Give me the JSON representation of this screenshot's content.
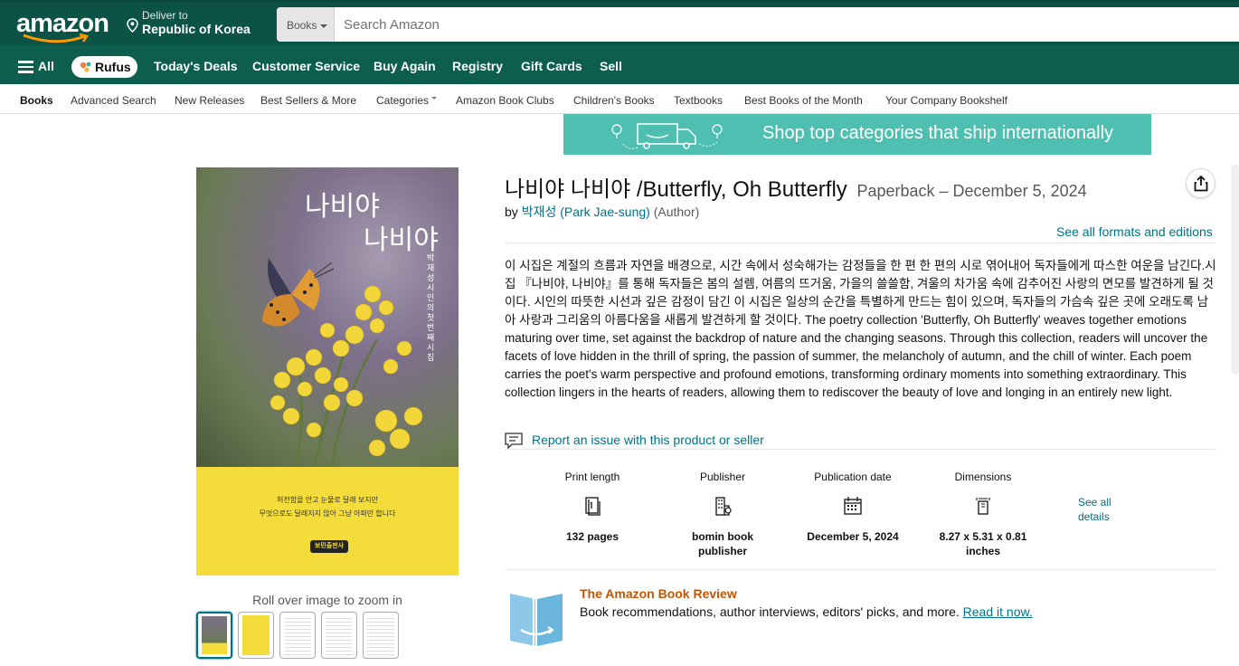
{
  "header": {
    "logo_text": "amazon",
    "deliver_label": "Deliver to",
    "deliver_location": "Republic of Korea",
    "search_category": "Books",
    "search_placeholder": "Search Amazon"
  },
  "main_nav": {
    "all_label": "All",
    "rufus_label": "Rufus",
    "items": [
      "Today's Deals",
      "Customer Service",
      "Buy Again",
      "Registry",
      "Gift Cards",
      "Sell"
    ]
  },
  "sub_nav": {
    "items": [
      "Books",
      "Advanced Search",
      "New Releases",
      "Best Sellers & More",
      "Categories",
      "Amazon Book Clubs",
      "Children's Books",
      "Textbooks",
      "Best Books of the Month",
      "Your Company Bookshelf"
    ]
  },
  "banner": {
    "text": "Shop top categories that ship internationally"
  },
  "cover": {
    "title_line1": "나비야",
    "title_line2": "나비야",
    "vertical_text": "박재성 시인의 첫 번째 시집",
    "tagline1": "허전함을 안고 눈물로 달래 보지만",
    "tagline2": "무엇으로도 달래지지 않아 그냥 아파만 합니다",
    "publisher_logo": "보민출판사"
  },
  "gallery": {
    "zoom_hint": "Roll over image to zoom in"
  },
  "product": {
    "title": "나비야 나비야 /Butterfly, Oh Butterfly",
    "format": "Paperback – December 5, 2024",
    "by": "by",
    "author": "박재성 (Park Jae-sung)",
    "author_role": "(Author)",
    "see_formats": "See all formats and editions",
    "description": "이 시집은 계절의 흐름과 자연을 배경으로, 시간 속에서 성숙해가는 감정들을 한 편 한 편의 시로 엮어내어 독자들에게 따스한 여운을 남긴다.시집 『나비야, 나비야』를 통해 독자들은 봄의 설렘, 여름의 뜨거움, 가을의 쓸쓸함, 겨울의 차가움 속에 감추어진 사랑의 면모를 발견하게 될 것이다. 시인의 따뜻한 시선과 깊은 감정이 담긴 이 시집은 일상의 순간을 특별하게 만드는 힘이 있으며, 독자들의 가슴속 깊은 곳에 오래도록 남아 사랑과 그리움의 아름다움을 새롭게 발견하게 할 것이다. The poetry collection 'Butterfly, Oh Butterfly' weaves together emotions maturing over time, set against the backdrop of nature and the changing seasons. Through this collection, readers will uncover the facets of love hidden in the thrill of spring, the passion of summer, the melancholy of autumn, and the chill of winter. Each poem carries the poet's warm perspective and profound emotions, transforming ordinary moments into something extraordinary. This collection lingers in the hearts of readers, allowing them to rediscover the beauty of love and longing in an entirely new light.",
    "report_link": "Report an issue with this product or seller"
  },
  "details": {
    "items": [
      {
        "label": "Print length",
        "value": "132 pages",
        "icon": "book-pages-icon"
      },
      {
        "label": "Publisher",
        "value": "bomin book publisher",
        "icon": "building-icon"
      },
      {
        "label": "Publication date",
        "value": "December 5, 2024",
        "icon": "calendar-icon"
      },
      {
        "label": "Dimensions",
        "value": "8.27 x 5.31 x 0.81 inches",
        "icon": "dimensions-icon"
      }
    ],
    "see_all": "See all details"
  },
  "review": {
    "heading": "The Amazon Book Review",
    "text": "Book recommendations, author interviews, editors' picks, and more.",
    "link": "Read it now."
  },
  "colors": {
    "nav_top": "#0b5346",
    "nav_second": "#0d5e4e",
    "link": "#007185",
    "banner": "#4fbfb2",
    "review_heading": "#c45500"
  }
}
